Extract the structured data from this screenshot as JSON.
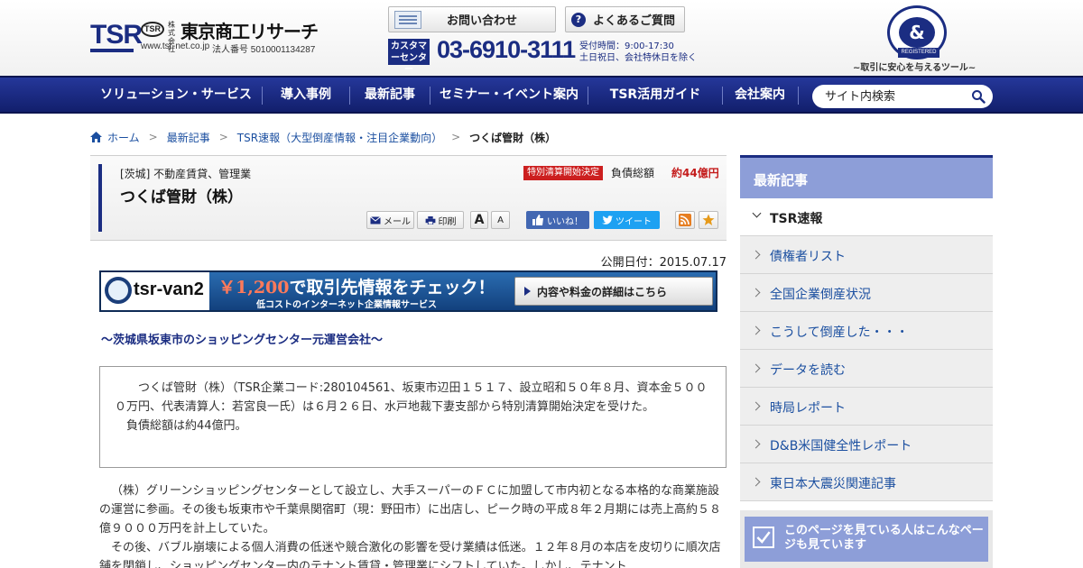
{
  "header": {
    "logo_text": "TSR",
    "logo_mark": "TSR",
    "kabushiki": "株式会社",
    "company_name": "東京商工リサーチ",
    "url": "www.tsr-net.co.jp",
    "corporate_number": "法人番号 5010001134287",
    "contact_label": "お問い合わせ",
    "faq_label": "よくあるご質問",
    "customer_center_label": "カスタマーセンター",
    "phone": "03-6910-3111",
    "hours_line1": "受付時間：9:00-17:30",
    "hours_line2": "土日祝日、会社特休日を除く",
    "dnb_mark": "&",
    "dnb_registered": "REGISTERED",
    "dnb_tagline": "~取引に安心を与えるツール~"
  },
  "nav": {
    "items": [
      "ソリューション・サービス",
      "導入事例",
      "最新記事",
      "セミナー・イベント案内",
      "TSR活用ガイド",
      "会社案内"
    ],
    "search_placeholder": "サイト内検索"
  },
  "breadcrumb": {
    "home": "ホーム",
    "level1": "最新記事",
    "level2": "TSR速報（大型倒産情報・注目企業動向）",
    "current": "つくば管財（株）"
  },
  "article": {
    "category": "[茨城] 不動産賃貸、管理業",
    "title": "つくば管財（株）",
    "badge": "特別清算開始決定",
    "debt_label": "負債総額",
    "debt_value": "約44億円",
    "mail_label": "メール",
    "print_label": "印刷",
    "font_large": "A",
    "font_small": "A",
    "like_label": "いいね！",
    "tweet_label": "ツイート",
    "published": "公開日付：2015.07.17",
    "lead": "～茨城県坂東市のショッピングセンター元運営会社～",
    "summary_p1": "つくば管財（株）（TSR企業コード:280104561、坂東市辺田１５１７、設立昭和５０年８月、資本金５０００万円、代表清算人：若宮良一氏）は６月２６日、水戸地裁下妻支部から特別清算開始決定を受けた。",
    "summary_p2": "負債総額は約44億円。",
    "body_p1": "（株）グリーンショッピングセンターとして設立し、大手スーパーのＦＣに加盟して市内初となる本格的な商業施設の運営に参画。その後も坂東市や千葉県関宿町（現：野田市）に出店し、ピーク時の平成８年２月期には売上高約５８億９０００万円を計上していた。",
    "body_p2": "その後、バブル崩壊による個人消費の低迷や競合激化の影響を受け業績は低迷。１２年８月の本店を皮切りに順次店舗を閉鎖し、ショッピングセンター内のテナント賃貸・管理業にシフトしていた。しかし、テナント"
  },
  "banner": {
    "logo_text": "tsr-van2",
    "price": "￥1,200",
    "headline_rest": "で取引先情報をチェック！",
    "sub": "低コストのインターネット企業情報サービス",
    "cta": "内容や料金の詳細はこちら"
  },
  "sidebar": {
    "title": "最新記事",
    "items": [
      "TSR速報",
      "債権者リスト",
      "全国企業倒産状況",
      "こうして倒産した・・・",
      "データを読む",
      "時局レポート",
      "D&B米国健全性レポート",
      "東日本大震災関連記事"
    ],
    "box_title": "このページを見ている人はこんなページも見ています"
  },
  "colors": {
    "brand_navy": "#1b2d82",
    "nav_bg": "#1e2f8a",
    "sidebar_header": "#8d9ed8",
    "alert_red": "#cc1f1f",
    "link_blue": "#1b4fa0"
  },
  "icons": [
    "search-icon",
    "home-icon",
    "chevron-right-icon",
    "mail-icon",
    "print-icon",
    "rss-icon",
    "star-icon",
    "check-icon",
    "question-icon",
    "contact-form-icon",
    "facebook-like-icon",
    "twitter-icon"
  ]
}
